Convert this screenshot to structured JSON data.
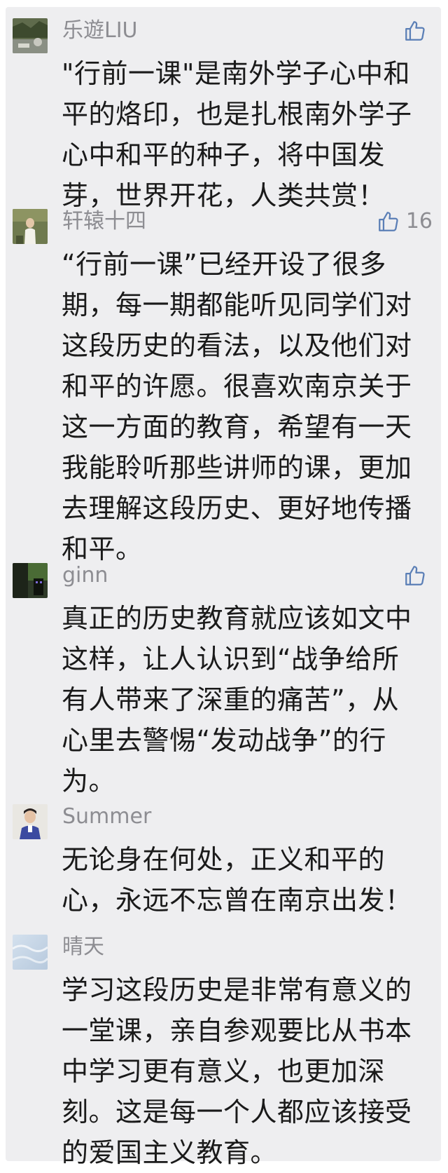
{
  "comments": [
    {
      "nickname": "乐遊LIU",
      "like_count": "",
      "text": "\"行前一课\"是南外学子心中和\n平的烙印，也是扎根南外学子\n心中和平的种子，将中国发\n芽，世界开花，人类共赏！"
    },
    {
      "nickname": "轩辕十四",
      "like_count": "16",
      "text": "“行前一课”已经开设了很多\n期，每一期都能听见同学们对\n这段历史的看法，以及他们对\n和平的许愿。很喜欢南京关于\n这一方面的教育，希望有一天\n我能聆听那些讲师的课，更加\n去理解这段历史、更好地传播\n和平。"
    },
    {
      "nickname": "ginn",
      "like_count": "",
      "text": "真正的历史教育就应该如文中\n这样，让人认识到“战争给所\n有人带来了深重的痛苦”，从\n心里去警惕“发动战争”的行\n为。"
    },
    {
      "nickname": "Summer",
      "like_count": "",
      "text": "无论身在何处，正义和平的\n心，永远不忘曾在南京出发！"
    },
    {
      "nickname": "晴天",
      "like_count": "",
      "text": "学习这段历史是非常有意义的\n一堂课，亲自参观要比从书本\n中学习更有意义，也更加深\n刻。这是每一个人都应该接受\n的爱国主义教育。"
    }
  ],
  "icons": {
    "like": "thumbs-up-icon"
  },
  "colors": {
    "panel_background": "#eeeef0",
    "nickname": "#8d8d92",
    "body_text": "#1a1a1a",
    "like_icon": "#5b7fb6"
  }
}
